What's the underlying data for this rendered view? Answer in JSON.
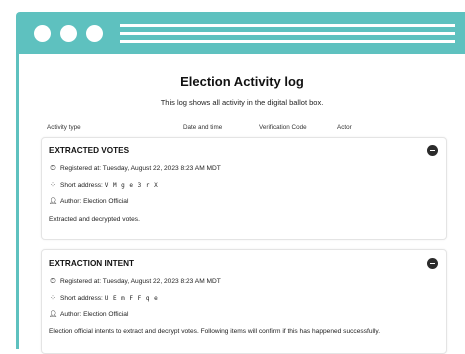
{
  "page": {
    "title": "Election Activity log",
    "subtitle": "This log shows all activity in the digital ballot box."
  },
  "columns": [
    "Activity type",
    "Date and time",
    "Verification Code",
    "Actor"
  ],
  "entries": [
    {
      "title": "EXTRACTED VOTES",
      "registered_label": "Registered at:",
      "registered_value": "Tuesday, August 22, 2023 8:23 AM MDT",
      "short_label": "Short address:",
      "short_value": "V M g e 3 r X",
      "author_label": "Author:",
      "author_value": "Election Official",
      "description": "Extracted and decrypted votes."
    },
    {
      "title": "EXTRACTION INTENT",
      "registered_label": "Registered at:",
      "registered_value": "Tuesday, August 22, 2023 8:23 AM MDT",
      "short_label": "Short address:",
      "short_value": "U E m F F q e",
      "author_label": "Author:",
      "author_value": "Election Official",
      "description": "Election official intents to extract and decrypt votes. Following items will confirm if this has happened successfully."
    }
  ],
  "icons": {
    "registered": "clock-icon",
    "short": "fingerprint-icon",
    "author": "user-icon",
    "toggle": "collapse-icon"
  },
  "colors": {
    "accent": "#5ec1bf"
  }
}
